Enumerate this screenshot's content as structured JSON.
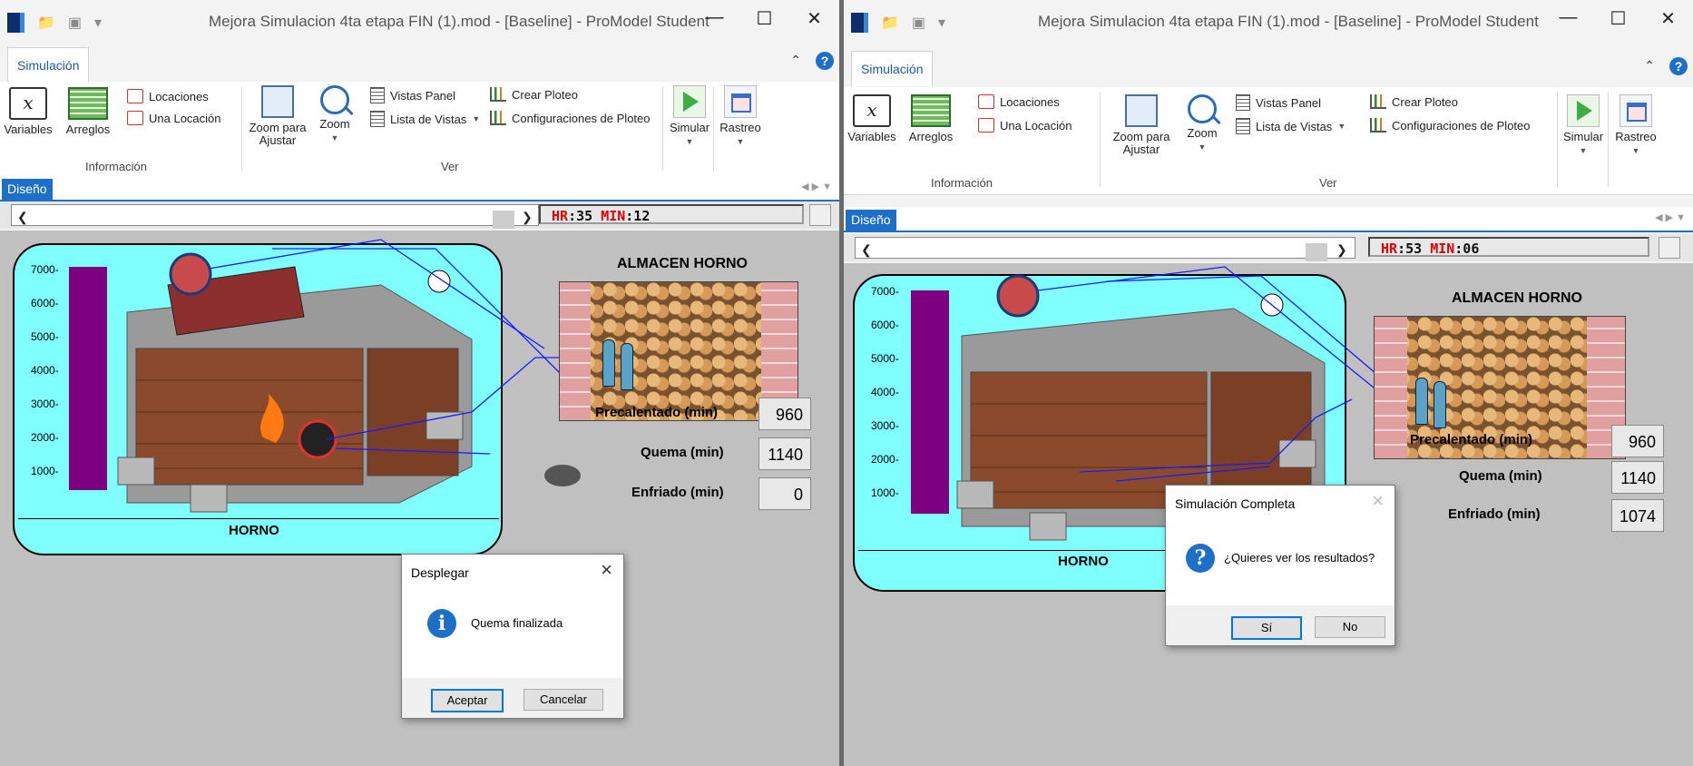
{
  "windows": [
    {
      "title": "Mejora Simulacion 4ta etapa FIN (1).mod - [Baseline] - ProModel Student",
      "ribbon_tab": "Simulación",
      "ribbon": {
        "variables": "Variables",
        "arreglos": "Arreglos",
        "locaciones": "Locaciones",
        "una_locacion": "Una Locación",
        "group_info": "Información",
        "zoom_ajustar": "Zoom para Ajustar",
        "zoom": "Zoom",
        "vistas_panel": "Vistas Panel",
        "lista_vistas": "Lista de Vistas",
        "crear_ploteo": "Crear Ploteo",
        "config_ploteo": "Configuraciones de Ploteo",
        "group_ver": "Ver",
        "simular": "Simular",
        "rastreo": "Rastreo"
      },
      "doc_tab": "Diseño",
      "clock": {
        "hr_label": "HR",
        "hr_value": ":35",
        "min_label": "MIN",
        "min_value": ":12"
      },
      "oven_label": "HORNO",
      "y_ticks": [
        "7000-",
        "6000-",
        "5000-",
        "4000-",
        "3000-",
        "2000-",
        "1000-"
      ],
      "store_title": "ALMACEN HORNO",
      "fields": [
        {
          "label": "Precalentado (min)",
          "value": "960"
        },
        {
          "label": "Quema (min)",
          "value": "1140"
        },
        {
          "label": "Enfriado (min)",
          "value": "0"
        }
      ],
      "dialog": {
        "title": "Desplegar",
        "icon": "info-icon",
        "message": "Quema finalizada",
        "ok": "Aceptar",
        "cancel": "Cancelar"
      }
    },
    {
      "title": "Mejora Simulacion 4ta etapa FIN (1).mod - [Baseline] - ProModel Student",
      "ribbon_tab": "Simulación",
      "ribbon": {
        "variables": "Variables",
        "arreglos": "Arreglos",
        "locaciones": "Locaciones",
        "una_locacion": "Una Locación",
        "group_info": "Información",
        "zoom_ajustar": "Zoom para Ajustar",
        "zoom": "Zoom",
        "vistas_panel": "Vistas Panel",
        "lista_vistas": "Lista de Vistas",
        "crear_ploteo": "Crear Ploteo",
        "config_ploteo": "Configuraciones de Ploteo",
        "group_ver": "Ver",
        "simular": "Simular",
        "rastreo": "Rastreo"
      },
      "doc_tab": "Diseño",
      "clock": {
        "hr_label": "HR",
        "hr_value": ":53",
        "min_label": "MIN",
        "min_value": ":06"
      },
      "oven_label": "HORNO",
      "y_ticks": [
        "7000-",
        "6000-",
        "5000-",
        "4000-",
        "3000-",
        "2000-",
        "1000-"
      ],
      "store_title": "ALMACEN HORNO",
      "fields": [
        {
          "label": "Precalentado (min)",
          "value": "960"
        },
        {
          "label": "Quema (min)",
          "value": "1140"
        },
        {
          "label": "Enfriado (min)",
          "value": "1074"
        }
      ],
      "dialog": {
        "title": "Simulación Completa",
        "icon": "question-icon",
        "message": "¿Quieres ver los resultados?",
        "ok": "Sí",
        "cancel": "No"
      }
    }
  ],
  "colors": {
    "oven_panel": "#80ffff",
    "level_bar": "#7d0080",
    "clock_red": "#e00000",
    "accent": "#1e6fc8"
  }
}
